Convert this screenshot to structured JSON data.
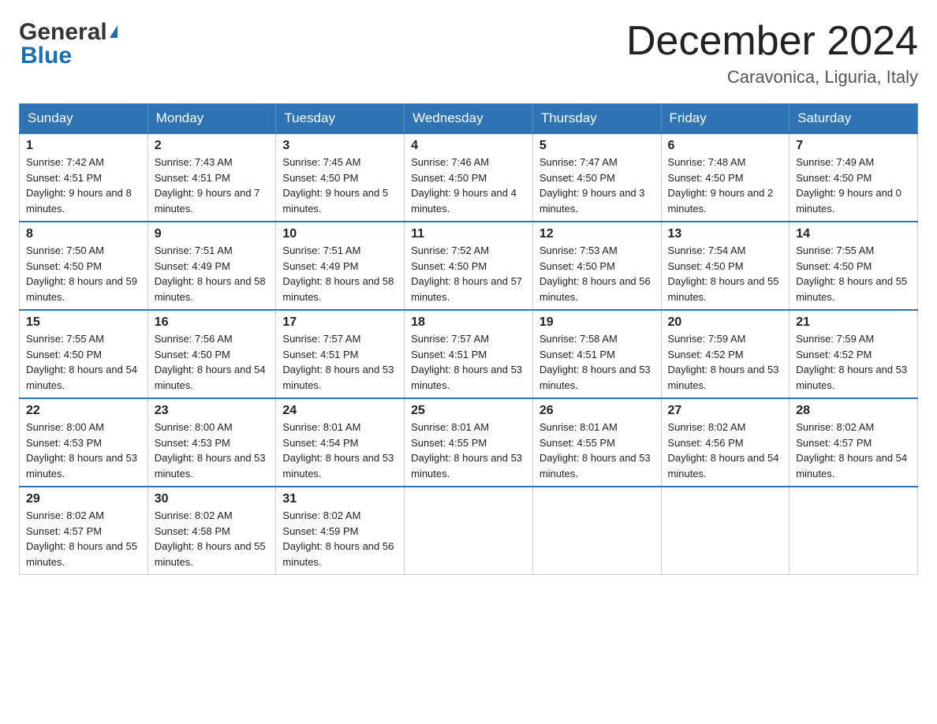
{
  "header": {
    "logo_general": "General",
    "logo_blue": "Blue",
    "month_title": "December 2024",
    "location": "Caravonica, Liguria, Italy"
  },
  "days_of_week": [
    "Sunday",
    "Monday",
    "Tuesday",
    "Wednesday",
    "Thursday",
    "Friday",
    "Saturday"
  ],
  "weeks": [
    [
      {
        "day": "1",
        "sunrise": "7:42 AM",
        "sunset": "4:51 PM",
        "daylight": "9 hours and 8 minutes."
      },
      {
        "day": "2",
        "sunrise": "7:43 AM",
        "sunset": "4:51 PM",
        "daylight": "9 hours and 7 minutes."
      },
      {
        "day": "3",
        "sunrise": "7:45 AM",
        "sunset": "4:50 PM",
        "daylight": "9 hours and 5 minutes."
      },
      {
        "day": "4",
        "sunrise": "7:46 AM",
        "sunset": "4:50 PM",
        "daylight": "9 hours and 4 minutes."
      },
      {
        "day": "5",
        "sunrise": "7:47 AM",
        "sunset": "4:50 PM",
        "daylight": "9 hours and 3 minutes."
      },
      {
        "day": "6",
        "sunrise": "7:48 AM",
        "sunset": "4:50 PM",
        "daylight": "9 hours and 2 minutes."
      },
      {
        "day": "7",
        "sunrise": "7:49 AM",
        "sunset": "4:50 PM",
        "daylight": "9 hours and 0 minutes."
      }
    ],
    [
      {
        "day": "8",
        "sunrise": "7:50 AM",
        "sunset": "4:50 PM",
        "daylight": "8 hours and 59 minutes."
      },
      {
        "day": "9",
        "sunrise": "7:51 AM",
        "sunset": "4:49 PM",
        "daylight": "8 hours and 58 minutes."
      },
      {
        "day": "10",
        "sunrise": "7:51 AM",
        "sunset": "4:49 PM",
        "daylight": "8 hours and 58 minutes."
      },
      {
        "day": "11",
        "sunrise": "7:52 AM",
        "sunset": "4:50 PM",
        "daylight": "8 hours and 57 minutes."
      },
      {
        "day": "12",
        "sunrise": "7:53 AM",
        "sunset": "4:50 PM",
        "daylight": "8 hours and 56 minutes."
      },
      {
        "day": "13",
        "sunrise": "7:54 AM",
        "sunset": "4:50 PM",
        "daylight": "8 hours and 55 minutes."
      },
      {
        "day": "14",
        "sunrise": "7:55 AM",
        "sunset": "4:50 PM",
        "daylight": "8 hours and 55 minutes."
      }
    ],
    [
      {
        "day": "15",
        "sunrise": "7:55 AM",
        "sunset": "4:50 PM",
        "daylight": "8 hours and 54 minutes."
      },
      {
        "day": "16",
        "sunrise": "7:56 AM",
        "sunset": "4:50 PM",
        "daylight": "8 hours and 54 minutes."
      },
      {
        "day": "17",
        "sunrise": "7:57 AM",
        "sunset": "4:51 PM",
        "daylight": "8 hours and 53 minutes."
      },
      {
        "day": "18",
        "sunrise": "7:57 AM",
        "sunset": "4:51 PM",
        "daylight": "8 hours and 53 minutes."
      },
      {
        "day": "19",
        "sunrise": "7:58 AM",
        "sunset": "4:51 PM",
        "daylight": "8 hours and 53 minutes."
      },
      {
        "day": "20",
        "sunrise": "7:59 AM",
        "sunset": "4:52 PM",
        "daylight": "8 hours and 53 minutes."
      },
      {
        "day": "21",
        "sunrise": "7:59 AM",
        "sunset": "4:52 PM",
        "daylight": "8 hours and 53 minutes."
      }
    ],
    [
      {
        "day": "22",
        "sunrise": "8:00 AM",
        "sunset": "4:53 PM",
        "daylight": "8 hours and 53 minutes."
      },
      {
        "day": "23",
        "sunrise": "8:00 AM",
        "sunset": "4:53 PM",
        "daylight": "8 hours and 53 minutes."
      },
      {
        "day": "24",
        "sunrise": "8:01 AM",
        "sunset": "4:54 PM",
        "daylight": "8 hours and 53 minutes."
      },
      {
        "day": "25",
        "sunrise": "8:01 AM",
        "sunset": "4:55 PM",
        "daylight": "8 hours and 53 minutes."
      },
      {
        "day": "26",
        "sunrise": "8:01 AM",
        "sunset": "4:55 PM",
        "daylight": "8 hours and 53 minutes."
      },
      {
        "day": "27",
        "sunrise": "8:02 AM",
        "sunset": "4:56 PM",
        "daylight": "8 hours and 54 minutes."
      },
      {
        "day": "28",
        "sunrise": "8:02 AM",
        "sunset": "4:57 PM",
        "daylight": "8 hours and 54 minutes."
      }
    ],
    [
      {
        "day": "29",
        "sunrise": "8:02 AM",
        "sunset": "4:57 PM",
        "daylight": "8 hours and 55 minutes."
      },
      {
        "day": "30",
        "sunrise": "8:02 AM",
        "sunset": "4:58 PM",
        "daylight": "8 hours and 55 minutes."
      },
      {
        "day": "31",
        "sunrise": "8:02 AM",
        "sunset": "4:59 PM",
        "daylight": "8 hours and 56 minutes."
      },
      null,
      null,
      null,
      null
    ]
  ],
  "labels": {
    "sunrise": "Sunrise:",
    "sunset": "Sunset:",
    "daylight": "Daylight:"
  }
}
